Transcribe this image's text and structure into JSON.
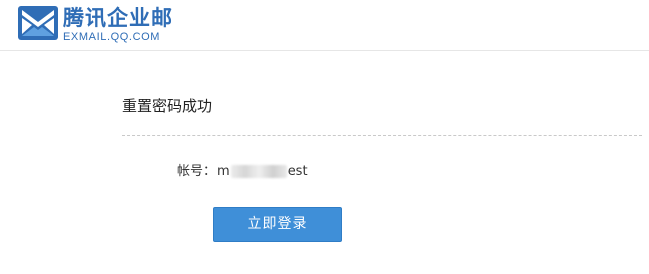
{
  "header": {
    "logo_title": "腾讯企业邮",
    "logo_subtitle": "EXMAIL.QQ.COM",
    "logo_icon": "envelope-icon",
    "brand_color": "#2f6db6"
  },
  "main": {
    "title": "重置密码成功",
    "account": {
      "label": "帐号：",
      "value_start": "m",
      "value_end": "est"
    },
    "login_button_label": "立即登录",
    "button_color": "#3f8fd8"
  }
}
